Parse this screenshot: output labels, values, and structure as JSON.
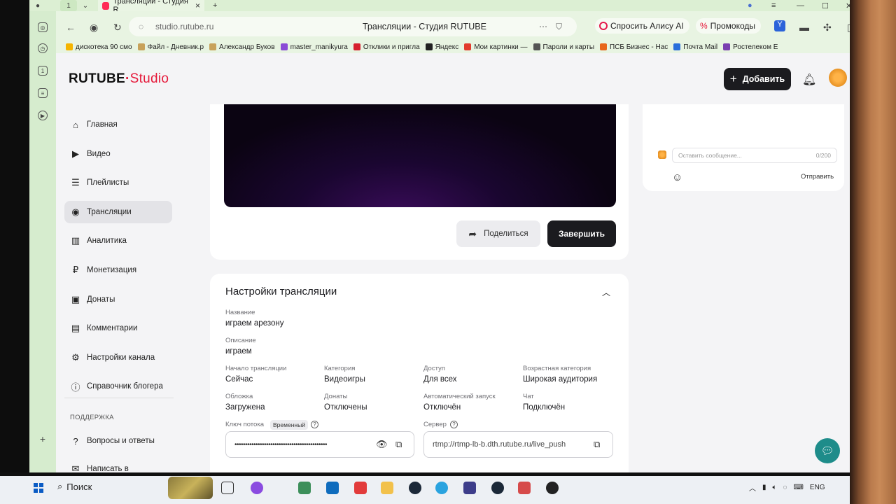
{
  "browser": {
    "tab_count_badge": "1",
    "active_tab_title": "Трансляции - Студия R",
    "url": "studio.rutube.ru",
    "page_title": "Трансляции - Студия RUTUBE",
    "alice_button": "Спросить Алису AI",
    "promo_button": "Промокоды",
    "bookmarks": [
      {
        "label": "дискотека 90 смо",
        "color": "#f5b400"
      },
      {
        "label": "Файл - Дневник.р",
        "color": "#c8a25a"
      },
      {
        "label": "Александр Буков",
        "color": "#c8a25a"
      },
      {
        "label": "master_manikyura",
        "color": "#8a4bd6"
      },
      {
        "label": "Отклики и пригла",
        "color": "#d6202d"
      },
      {
        "label": "Яндекс",
        "color": "#222222"
      },
      {
        "label": "Мои картинки —",
        "color": "#e23b2d"
      },
      {
        "label": "Пароли и карты",
        "color": "#555555"
      },
      {
        "label": "ПСБ Бизнес - Нас",
        "color": "#e8661b"
      },
      {
        "label": "Почта Mail",
        "color": "#2a6fdb"
      },
      {
        "label": "Ростелеком E",
        "color": "#7a3fb0"
      }
    ]
  },
  "studio": {
    "logo_main": "RUTUBE",
    "logo_sub": "Studio",
    "add_button": "Добавить",
    "sidebar": [
      {
        "label": "Главная",
        "icon": "home-icon",
        "glyph": "⌂"
      },
      {
        "label": "Видео",
        "icon": "video-icon",
        "glyph": "▶"
      },
      {
        "label": "Плейлисты",
        "icon": "playlist-icon",
        "glyph": "☰"
      },
      {
        "label": "Трансляции",
        "icon": "broadcast-icon",
        "glyph": "◉",
        "active": true
      },
      {
        "label": "Аналитика",
        "icon": "analytics-icon",
        "glyph": "▥"
      },
      {
        "label": "Монетизация",
        "icon": "ruble-icon",
        "glyph": "₽"
      },
      {
        "label": "Донаты",
        "icon": "wallet-icon",
        "glyph": "▣"
      },
      {
        "label": "Комментарии",
        "icon": "comments-icon",
        "glyph": "▤"
      },
      {
        "label": "Настройки канала",
        "icon": "gear-icon",
        "glyph": "⚙"
      },
      {
        "label": "Справочник блогера",
        "icon": "info-icon",
        "glyph": "ⓘ"
      }
    ],
    "support_label": "ПОДДЕРЖКА",
    "support_items": [
      {
        "label": "Вопросы и ответы",
        "icon": "question-icon",
        "glyph": "?"
      },
      {
        "label": "Написать в",
        "icon": "chat-icon",
        "glyph": "✉"
      }
    ],
    "share_button": "Поделиться",
    "finish_button": "Завершить",
    "settings": {
      "title": "Настройки трансляции",
      "name_label": "Название",
      "name_value": "играем арезону",
      "description_label": "Описание",
      "description_value": "играем",
      "fields_row1": [
        {
          "label": "Начало трансляции",
          "value": "Сейчас"
        },
        {
          "label": "Категория",
          "value": "Видеоигры"
        },
        {
          "label": "Доступ",
          "value": "Для всех"
        },
        {
          "label": "Возрастная категория",
          "value": "Широкая аудитория"
        }
      ],
      "fields_row2": [
        {
          "label": "Обложка",
          "value": "Загружена"
        },
        {
          "label": "Донаты",
          "value": "Отключены"
        },
        {
          "label": "Автоматический запуск",
          "value": "Отключён"
        },
        {
          "label": "Чат",
          "value": "Подключён"
        }
      ],
      "stream_key_label": "Ключ потока",
      "stream_key_badge": "Временный",
      "stream_key_value": "••••••••••••••••••••••••••••••••••••••••••••",
      "server_label": "Сервер",
      "server_value": "rtmp://rtmp-lb-b.dth.rutube.ru/live_push"
    },
    "chat": {
      "placeholder": "Оставить сообщение...",
      "counter": "0/200",
      "send_button": "Отправить"
    }
  },
  "taskbar": {
    "search_label": "Поиск",
    "language": "ENG"
  }
}
